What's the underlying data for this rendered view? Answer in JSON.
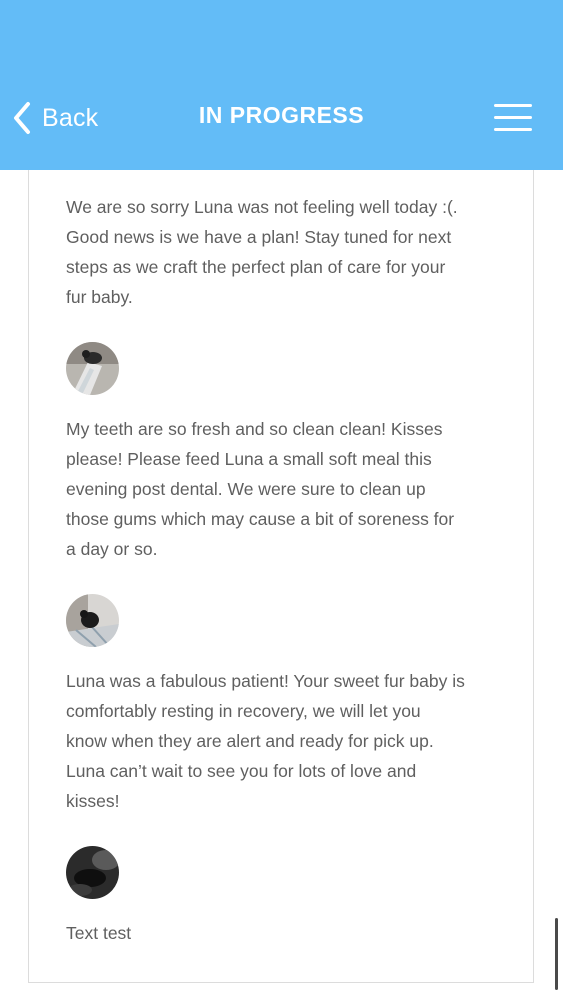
{
  "header": {
    "back_label": "Back",
    "title": "IN PROGRESS",
    "color": "#63bcf7"
  },
  "messages": [
    {
      "text": "We are so sorry Luna was not feeling well today :(.  Good news is we have a plan!  Stay tuned for next steps as we craft the perfect plan of care for your fur baby."
    },
    {
      "text": "My teeth are so fresh and so clean clean!  Kisses please!  Please feed Luna a small soft meal this evening post dental.  We were sure to clean up those gums which may cause a bit of soreness for a day or so."
    },
    {
      "text": "Luna was a fabulous patient!  Your sweet fur baby is comfortably resting in recovery, we will let you know when they are alert and ready for pick up.  Luna can’t wait to see you for lots of love and kisses!"
    },
    {
      "text": "Text test"
    }
  ],
  "icons": {
    "back": "chevron-left-icon",
    "menu": "hamburger-menu-icon"
  }
}
